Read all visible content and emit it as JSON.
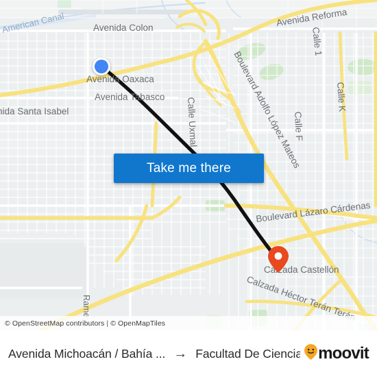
{
  "map": {
    "provider_attribution": {
      "osm": "© OpenStreetMap contributors",
      "separator": "|",
      "tiles": "© OpenMapTiles"
    },
    "cta": {
      "label": "Take me there"
    },
    "markers": {
      "start": {
        "name": "origin-marker",
        "color": "#4285f4"
      },
      "destination": {
        "name": "destination-marker",
        "color": "#e8491e"
      }
    },
    "labels": [
      {
        "id": "american-canal",
        "text": "American Canal",
        "type": "water"
      },
      {
        "id": "avenida-colon",
        "text": "Avenida Colon",
        "type": "road"
      },
      {
        "id": "avenida-reforma",
        "text": "Avenida Reforma",
        "type": "road"
      },
      {
        "id": "calle-1",
        "text": "Calle 1",
        "type": "road"
      },
      {
        "id": "calle-f",
        "text": "Calle F",
        "type": "road"
      },
      {
        "id": "calle-k",
        "text": "Calle K",
        "type": "road"
      },
      {
        "id": "blvd-lopez-mateos",
        "text": "Boulevard Adolfo López Mateos",
        "type": "road"
      },
      {
        "id": "avenida-oaxaca",
        "text": "Avenida Oaxaca",
        "type": "road"
      },
      {
        "id": "avenida-tabasco",
        "text": "Avenida Tabasco",
        "type": "road"
      },
      {
        "id": "avenida-santa-isabel",
        "text": "nida Santa Isabel",
        "type": "road"
      },
      {
        "id": "calle-uxmal",
        "text": "Calle Uxmal",
        "type": "road"
      },
      {
        "id": "blvd-lazaro-cardenas",
        "text": "Boulevard Lázaro Cárdenas",
        "type": "road"
      },
      {
        "id": "calzada-castellon",
        "text": "Calzada Castellón",
        "type": "road"
      },
      {
        "id": "calzada-teran",
        "text": "Calzada Héctor Terán Terán",
        "type": "road"
      },
      {
        "id": "ramirez",
        "text": "Rame",
        "type": "road"
      }
    ]
  },
  "footer": {
    "origin": "Avenida Michoacán / Bahía ...",
    "arrow": "→",
    "destination": "Facultad De Ciencia...",
    "brand": "moovit"
  },
  "colors": {
    "accent_blue": "#1177cd",
    "marker_blue": "#4285f4",
    "marker_orange": "#e8491e",
    "route_line": "#111111",
    "map_land": "#eceff0",
    "map_road_major": "#f9e9a0"
  }
}
